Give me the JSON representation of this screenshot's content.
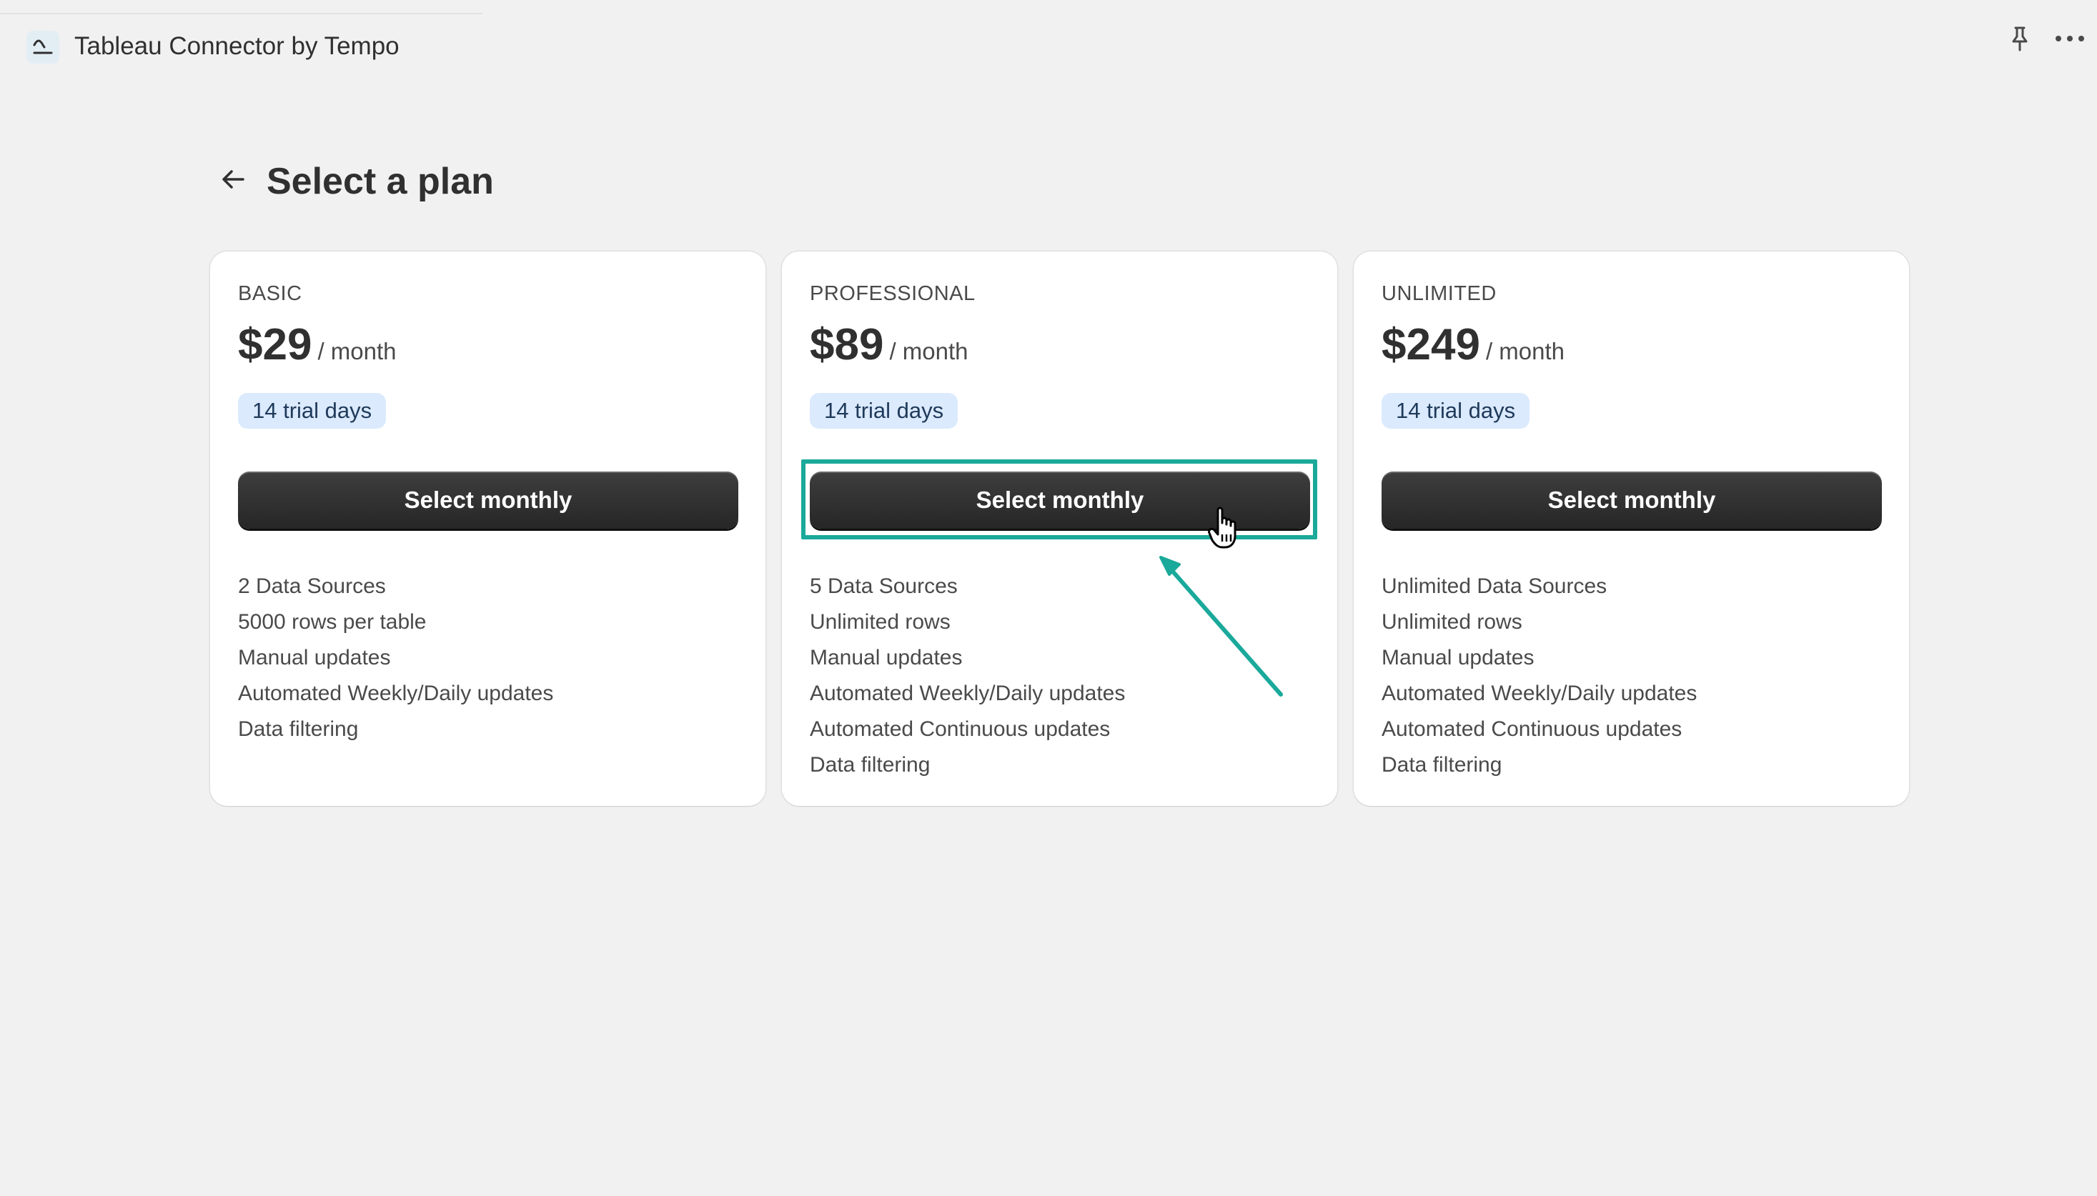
{
  "app": {
    "title": "Tableau Connector by Tempo"
  },
  "page": {
    "title": "Select a plan"
  },
  "plans": [
    {
      "name": "BASIC",
      "price": "$29",
      "period": "/ month",
      "trial": "14 trial days",
      "button_label": "Select monthly",
      "features": [
        "2 Data Sources",
        "5000 rows per table",
        "Manual updates",
        "Automated Weekly/Daily updates",
        "Data filtering"
      ]
    },
    {
      "name": "PROFESSIONAL",
      "price": "$89",
      "period": "/ month",
      "trial": "14 trial days",
      "button_label": "Select monthly",
      "features": [
        "5 Data Sources",
        "Unlimited rows",
        "Manual updates",
        "Automated Weekly/Daily updates",
        "Automated Continuous updates",
        "Data filtering"
      ]
    },
    {
      "name": "UNLIMITED",
      "price": "$249",
      "period": "/ month",
      "trial": "14 trial days",
      "button_label": "Select monthly",
      "features": [
        "Unlimited Data Sources",
        "Unlimited rows",
        "Manual updates",
        "Automated Weekly/Daily updates",
        "Automated Continuous updates",
        "Data filtering"
      ]
    }
  ],
  "icons": {
    "app": "chart-line-icon",
    "pin": "pin-icon",
    "more": "more-horizontal-icon",
    "back": "arrow-left-icon",
    "cursor": "hand-pointer-icon"
  },
  "colors": {
    "background": "#f1f1f1",
    "card": "#ffffff",
    "button": "#303030",
    "badge": "#dbeafd",
    "annotation": "#1aa99a"
  }
}
